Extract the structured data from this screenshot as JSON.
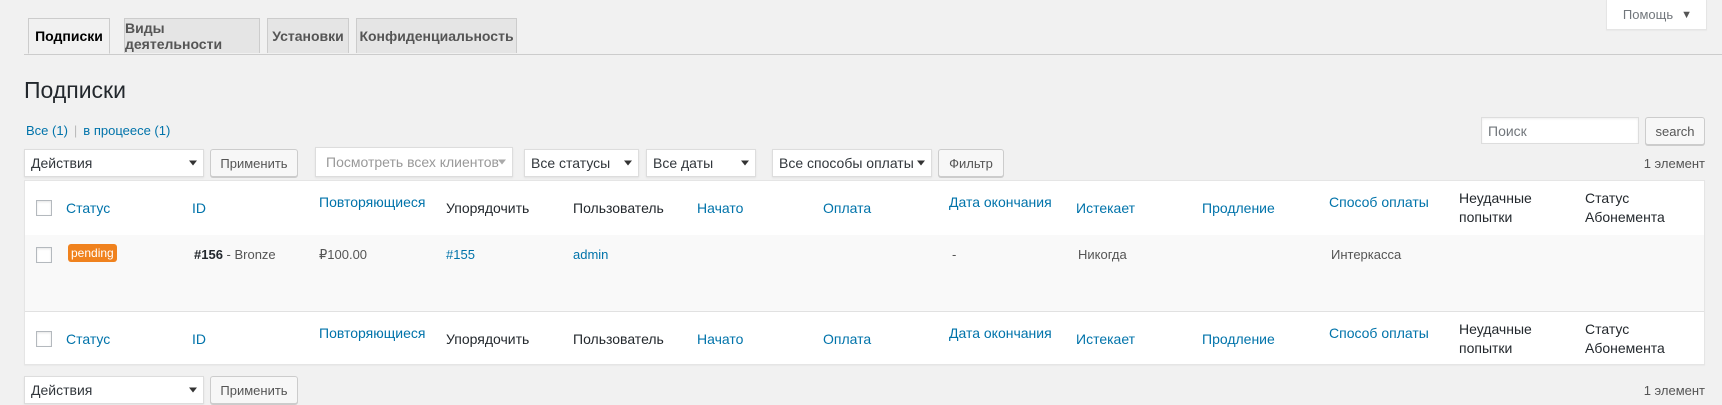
{
  "help_tab": {
    "label": "Помощь"
  },
  "tabs": [
    {
      "label": "Подписки",
      "active": true
    },
    {
      "label": "Виды деятельности",
      "active": false
    },
    {
      "label": "Установки",
      "active": false
    },
    {
      "label": "Конфиденциальность",
      "active": false
    }
  ],
  "page_title": "Подписки",
  "views": {
    "all": "Все (1)",
    "separator": "|",
    "in_progress": "в процеесе (1)"
  },
  "search": {
    "placeholder": "Поиск",
    "button": "search"
  },
  "bulk_top": {
    "selected": "Действия",
    "apply": "Применить"
  },
  "bulk_bottom": {
    "selected": "Действия",
    "apply": "Применить"
  },
  "filters": {
    "customers": "Посмотреть всех клиентов",
    "statuses": "Все статусы",
    "dates": "Все даты",
    "payment_methods": "Все способы оплаты",
    "filter_button": "Фильтр"
  },
  "items_count": "1 элемент",
  "columns": {
    "status": "Статус",
    "id": "ID",
    "recurring": "Повторяющиеся",
    "order": "Упорядочить",
    "user": "Пользователь",
    "start": "Начато",
    "payment": "Оплата",
    "end_date": "Дата окончания",
    "expires": "Истекает",
    "renewal": "Продление",
    "payment_method": "Способ оплаты",
    "failed_1": "Неудачные",
    "failed_2": "попытки",
    "sub_status_1": "Статус",
    "sub_status_2": "Абонемента"
  },
  "row": {
    "status_badge": "pending",
    "id": "#156",
    "plan": " - Bronze",
    "recurring": "₽100.00",
    "order": "#155",
    "user": "admin",
    "end_date": "-",
    "expires": "Никогда",
    "payment_method": "Интеркасса"
  },
  "colors": {
    "link": "#0073aa",
    "badge": "#f0821e",
    "background": "#f1f1f1"
  }
}
